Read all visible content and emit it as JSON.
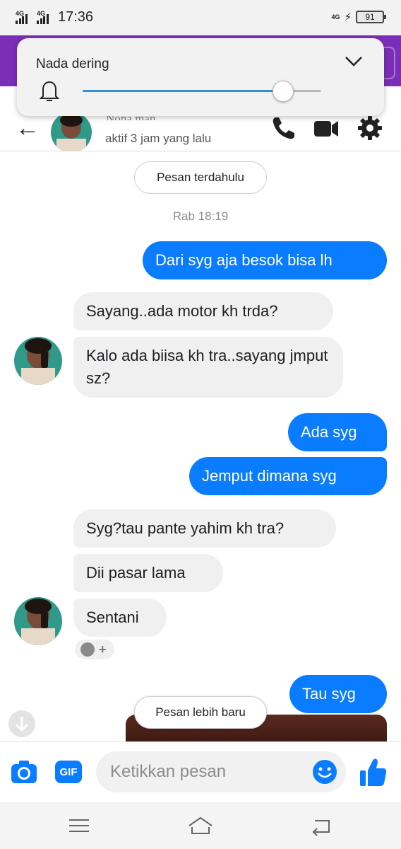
{
  "status_bar": {
    "sim1": "4G",
    "sim2": "4G",
    "time": "17:36",
    "network_right": "4G",
    "battery": "91"
  },
  "volume_panel": {
    "title": "Nada dering",
    "level": 0.84
  },
  "header": {
    "contact_name": "Nona man...",
    "status": "aktif 3 jam yang lalu"
  },
  "chat": {
    "older_button": "Pesan terdahulu",
    "timestamp": "Rab 18:19",
    "messages": [
      {
        "dir": "out",
        "text": "Dari syg aja besok bisa lh"
      },
      {
        "dir": "in",
        "text": "Sayang..ada motor kh trda?"
      },
      {
        "dir": "in",
        "text": "Kalo ada biisa kh tra..sayang jmput sz?"
      },
      {
        "dir": "out",
        "text": "Ada syg"
      },
      {
        "dir": "out",
        "text": "Jemput dimana syg"
      },
      {
        "dir": "in",
        "text": "Syg?tau pante yahim kh tra?"
      },
      {
        "dir": "in",
        "text": "Dii pasar lama"
      },
      {
        "dir": "in",
        "text": "Sentani"
      },
      {
        "dir": "out",
        "text": "Tau syg"
      }
    ],
    "newer_button": "Pesan lebih baru"
  },
  "composer": {
    "gif_label": "GIF",
    "placeholder": "Ketikkan pesan"
  },
  "colors": {
    "accent": "#0a7cff",
    "incoming_bubble": "#f1f0f0",
    "app_header": "#7b2fb8"
  },
  "icons": [
    "back-arrow-icon",
    "phone-icon",
    "video-camera-icon",
    "gear-icon",
    "bell-icon",
    "chevron-down-icon",
    "camera-icon",
    "emoji-icon",
    "thumbs-up-icon",
    "arrow-down-icon",
    "menu-icon",
    "home-icon",
    "back-nav-icon"
  ]
}
